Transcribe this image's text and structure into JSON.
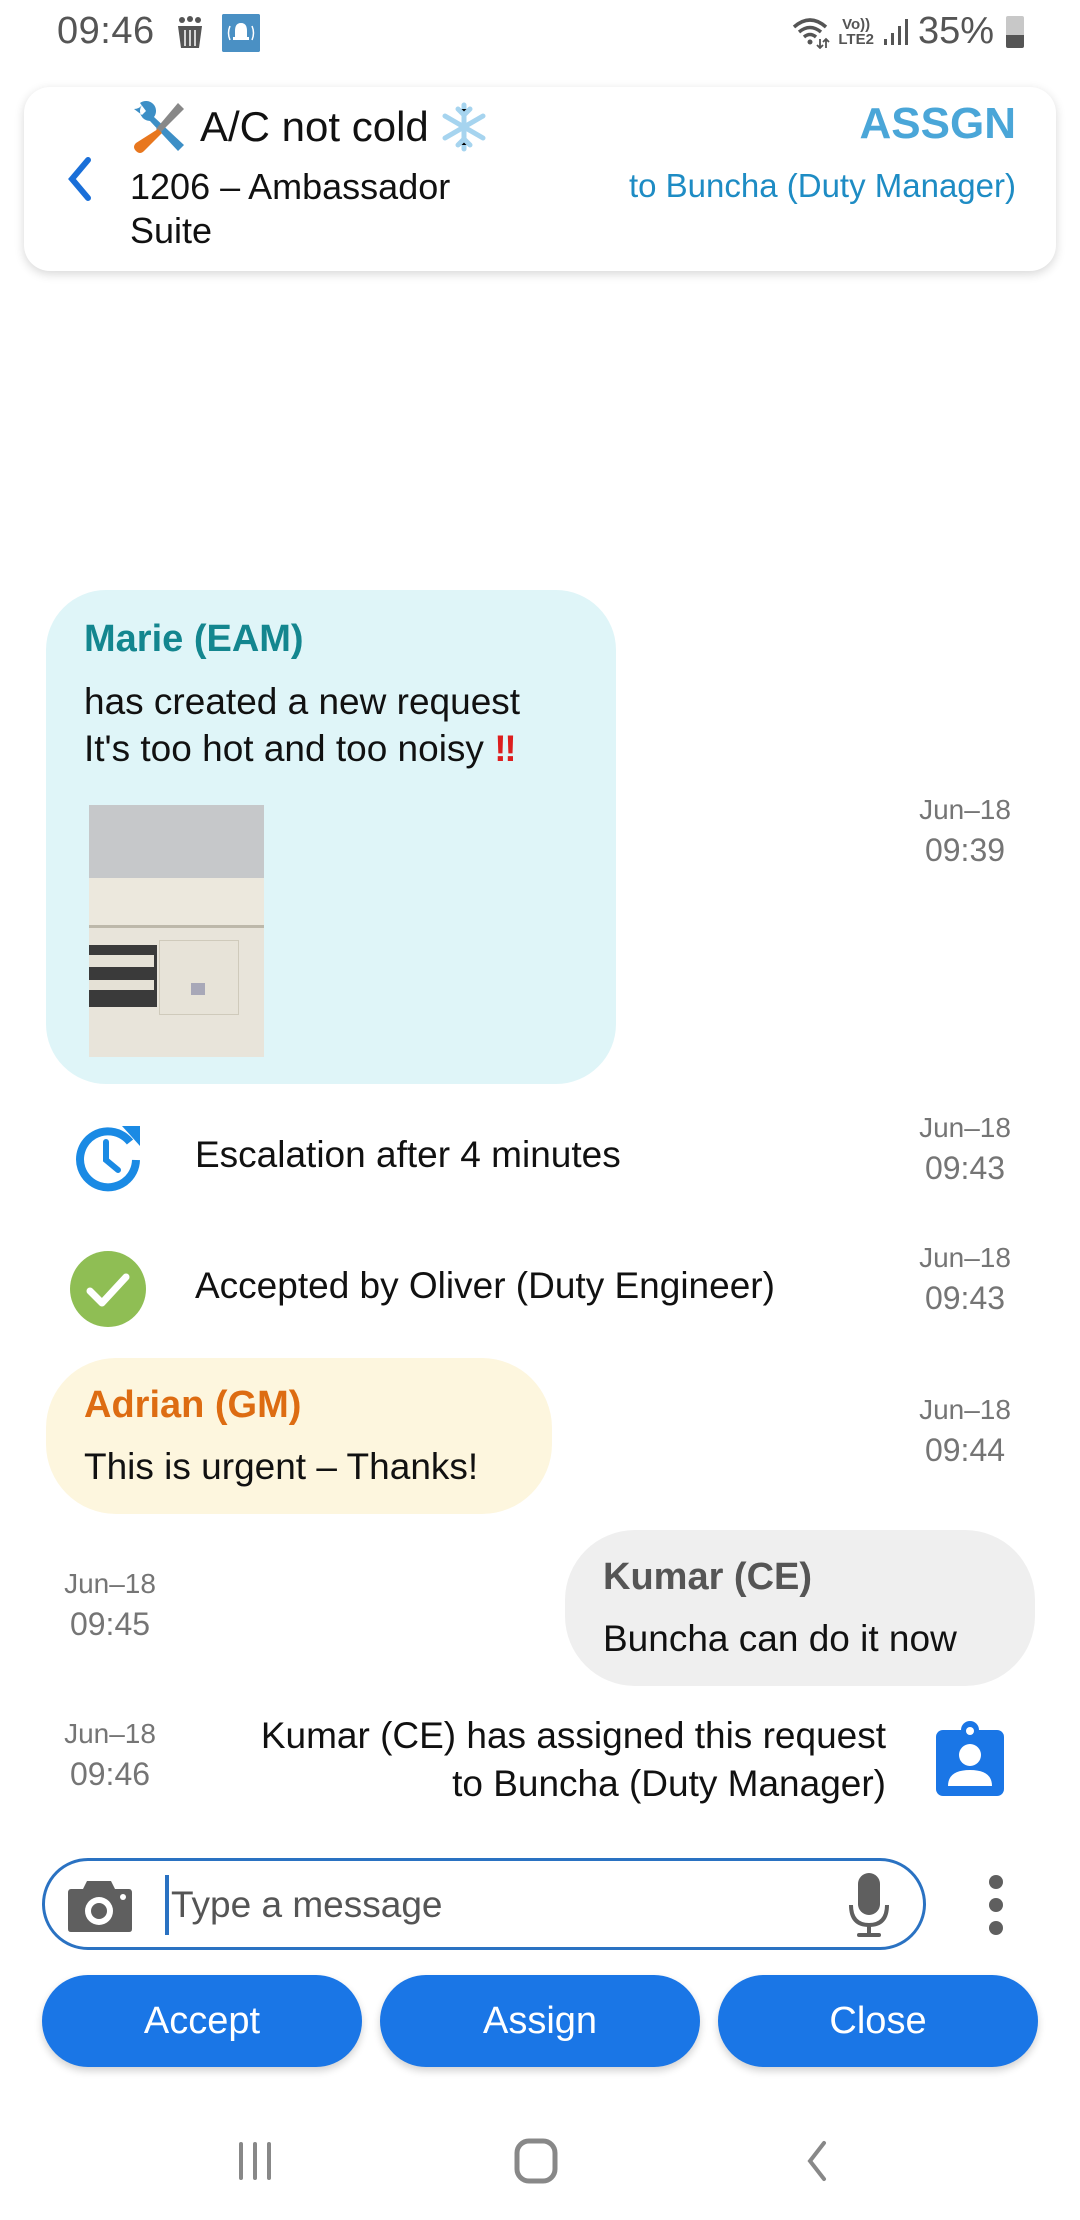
{
  "status_bar": {
    "time": "09:46",
    "battery_percent": "35%",
    "network_label_top": "Vo))",
    "network_label_bottom": "LTE2",
    "icons": [
      "app-notification-icon",
      "alarm-notification-icon",
      "wifi-icon",
      "volte-icon",
      "signal-icon",
      "battery-icon"
    ]
  },
  "header": {
    "title": "A/C not cold",
    "title_leading_icon": "tools-icon",
    "title_trailing_icon": "snowflake-icon",
    "room": "1206 – Ambassador Suite",
    "status": "ASSGN",
    "status_detail": "to Buncha (Duty Manager)",
    "colors": {
      "status": "#4aa6d8",
      "status_detail": "#1e8cc4"
    }
  },
  "messages": [
    {
      "type": "bubble",
      "sender": "Marie (EAM)",
      "line1": "has created a new request",
      "line2": "It's too hot and too noisy",
      "emphasis": "‼",
      "attachment": "air-conditioner-photo",
      "date": "Jun–18",
      "time": "09:39",
      "colors": {
        "bubble": "#dff5f8",
        "sender": "#13868f"
      }
    },
    {
      "type": "event",
      "icon": "escalation-clock-icon",
      "text": "Escalation after 4 minutes",
      "date": "Jun–18",
      "time": "09:43"
    },
    {
      "type": "event",
      "icon": "accepted-check-icon",
      "text": "Accepted by Oliver (Duty Engineer)",
      "date": "Jun–18",
      "time": "09:43"
    },
    {
      "type": "bubble",
      "sender": "Adrian (GM)",
      "text": "This is urgent – Thanks!",
      "date": "Jun–18",
      "time": "09:44",
      "colors": {
        "bubble": "#fdf6de",
        "sender": "#dd6c12"
      }
    },
    {
      "type": "bubble-outgoing",
      "sender": "Kumar (CE)",
      "text": "Buncha can do it now",
      "date": "Jun–18",
      "time": "09:45",
      "colors": {
        "bubble": "#efefef",
        "sender": "#555555"
      }
    },
    {
      "type": "event-outgoing",
      "icon": "assigned-badge-icon",
      "line1": "Kumar (CE) has assigned this request",
      "line2": "to Buncha (Duty Manager)",
      "date": "Jun–18",
      "time": "09:46"
    }
  ],
  "composer": {
    "placeholder": "Type a message",
    "value": ""
  },
  "actions": {
    "accept": "Accept",
    "assign": "Assign",
    "close": "Close",
    "color": "#1a76e6"
  }
}
